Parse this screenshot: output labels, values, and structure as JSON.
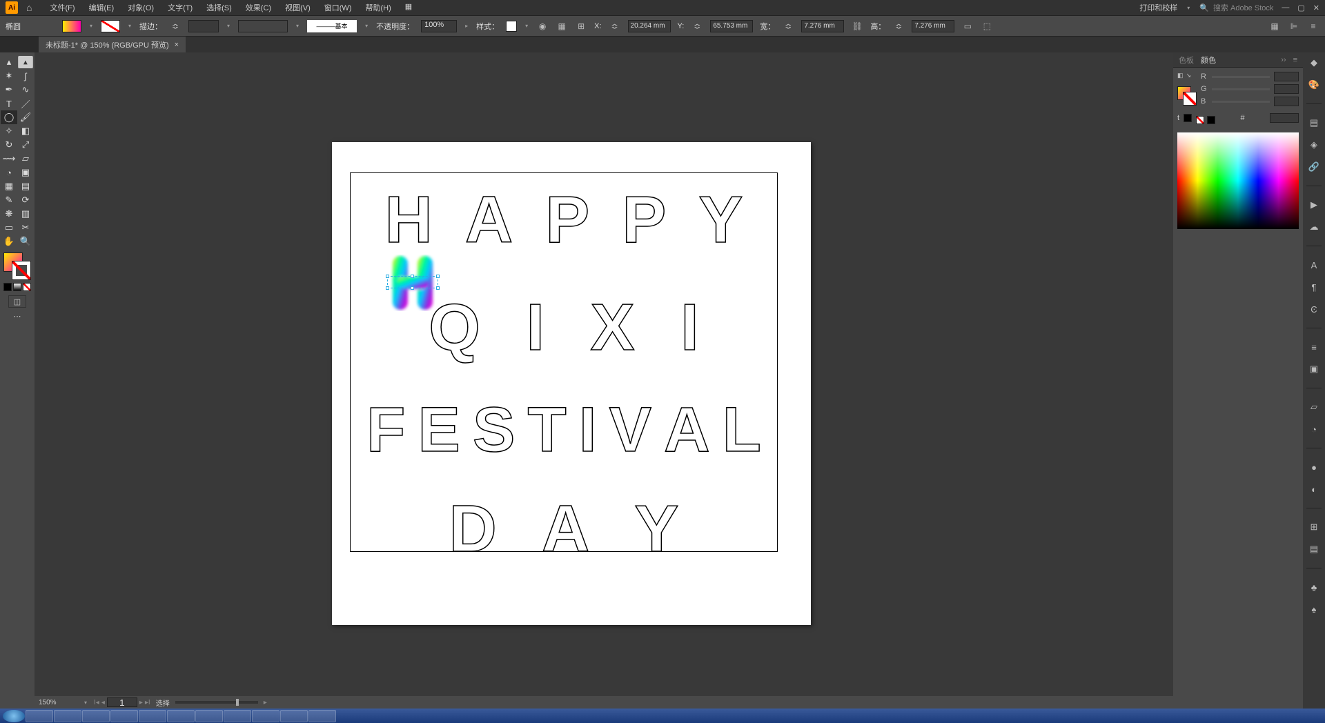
{
  "menu": {
    "items": [
      "文件(F)",
      "编辑(E)",
      "对象(O)",
      "文字(T)",
      "选择(S)",
      "效果(C)",
      "视图(V)",
      "窗口(W)",
      "帮助(H)"
    ],
    "workspace": "打印和校样",
    "search_ph": "搜索 Adobe Stock",
    "essentials": "▦"
  },
  "control": {
    "shape_label": "椭圆",
    "stroke_label": "描边：",
    "stroke_style_label": "基本",
    "opacity_label": "不透明度：",
    "opacity_value": "100%",
    "style_label": "样式：",
    "x_label": "X:",
    "x_val": "20.264 mm",
    "y_label": "Y:",
    "y_val": "65.753 mm",
    "w_label": "宽：",
    "w_val": "7.276 mm",
    "h_label": "高：",
    "h_val": "7.276 mm"
  },
  "tab": {
    "title": "未标题-1* @ 150% (RGB/GPU 预览)"
  },
  "art": {
    "row1": [
      "H",
      "A",
      "P",
      "P",
      "Y"
    ],
    "row2": [
      "Q",
      "I",
      "X",
      "I"
    ],
    "row3": [
      "F",
      "E",
      "S",
      "T",
      "I",
      "V",
      "A",
      "L"
    ],
    "row4": [
      "D",
      "A",
      "Y"
    ]
  },
  "panel": {
    "swatch_tab": "色板",
    "color_tab": "颜色",
    "r": "R",
    "g": "G",
    "b": "B",
    "hash": "#",
    "t": "t"
  },
  "status": {
    "zoom": "150%",
    "page": "1",
    "mode": "选择"
  },
  "colors": {
    "accent": "#ff9a00"
  }
}
